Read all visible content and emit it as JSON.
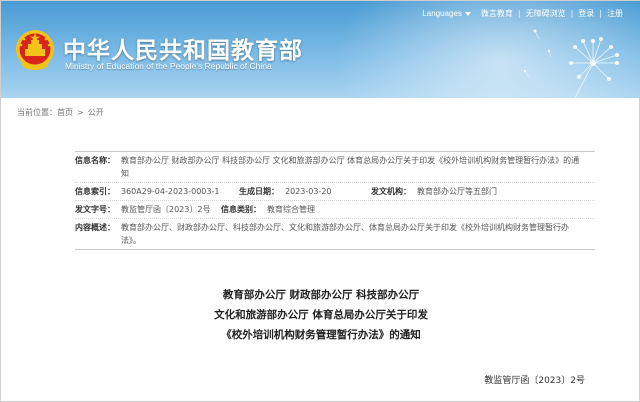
{
  "header": {
    "title": "中华人民共和国教育部",
    "subtitle": "Ministry of Education of the People's Republic of China",
    "nav": {
      "languages": "Languages",
      "weibo": "微言教育",
      "accessibility": "无障碍浏览",
      "login": "登录",
      "register": "注册"
    },
    "colors": {
      "banner_top": "#4a9bd3",
      "banner_bottom": "#a9d4f0",
      "emblem_red": "#d8261f",
      "emblem_gold": "#f3c319"
    }
  },
  "breadcrumb": {
    "label": "当前位置：",
    "home": "首页",
    "separator": ">",
    "current": "公开"
  },
  "info": {
    "name_label": "信息名称：",
    "name_value": "教育部办公厅 财政部办公厅 科技部办公厅 文化和旅游部办公厅 体育总局办公厅关于印发《校外培训机构财务管理暂行办法》的通知",
    "index_label": "信息索引：",
    "index_value": "360A29-04-2023-0003-1",
    "date_label": "生成日期：",
    "date_value": "2023-03-20",
    "issuer_label": "发文机构：",
    "issuer_value": "教育部办公厅等五部门",
    "docno_label": "发文字号：",
    "docno_value": "教监管厅函〔2023〕2号",
    "category_label": "信息类别：",
    "category_value": "教育综合管理",
    "summary_label": "内容概述：",
    "summary_value": "教育部办公厅、财政部办公厅、科技部办公厅、文化和旅游部办公厅、体育总局办公厅关于印发《校外培训机构财务管理暂行办法》。"
  },
  "document": {
    "title_line1": "教育部办公厅 财政部办公厅 科技部办公厅",
    "title_line2": "文化和旅游部办公厅 体育总局办公厅关于印发",
    "title_line3": "《校外培训机构财务管理暂行办法》的通知",
    "number": "教监管厅函〔2023〕2号"
  }
}
